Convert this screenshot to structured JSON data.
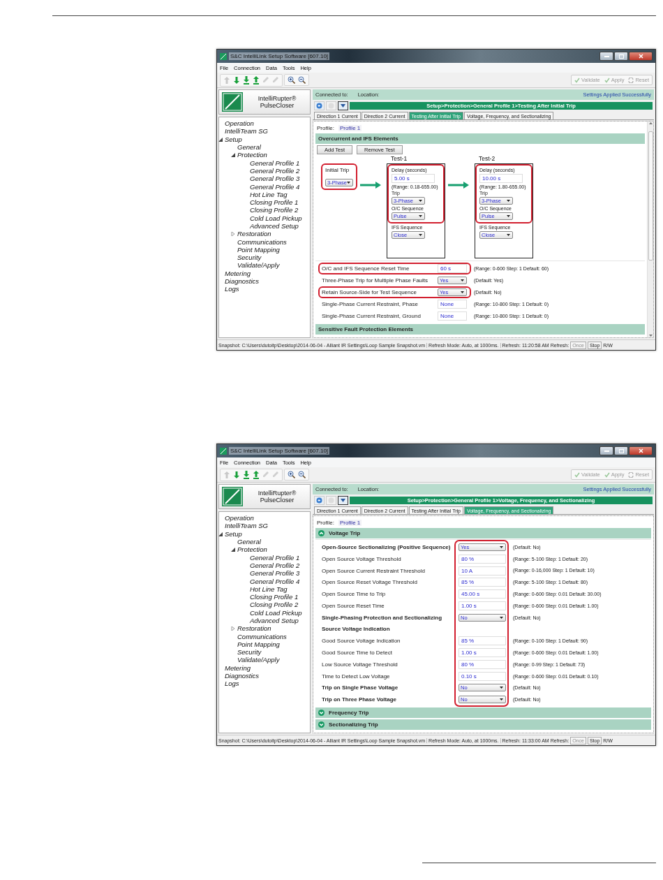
{
  "windows": [
    {
      "title": "S&C IntelliLink Setup Software [607.10]",
      "menu": [
        "File",
        "Connection",
        "Data",
        "Tools",
        "Help"
      ],
      "actions": [
        "Validate",
        "Apply",
        "Reset"
      ],
      "logo_lines": [
        "IntelliRupter®",
        "PulseCloser"
      ],
      "connected_label": "Connected to:",
      "location_label": "Location:",
      "status_message": "Settings Applied Successfully",
      "breadcrumb": "Setup>Protection>General Profile 1>Testing After Initial Trip",
      "tabs": [
        {
          "label": "Direction 1 Current",
          "selected": false
        },
        {
          "label": "Direction 2 Current",
          "selected": false
        },
        {
          "label": "Testing After Initial Trip",
          "selected": true
        },
        {
          "label": "Voltage, Frequency, and Sectionalizing",
          "selected": false
        }
      ],
      "sidebar": [
        {
          "label": "Operation"
        },
        {
          "label": "IntelliTeam SG"
        },
        {
          "label": "Setup",
          "expanded": true,
          "children": [
            {
              "label": "General"
            },
            {
              "label": "Protection",
              "expanded": true,
              "children": [
                {
                  "label": "General Profile 1"
                },
                {
                  "label": "General Profile 2"
                },
                {
                  "label": "General Profile 3"
                },
                {
                  "label": "General Profile 4"
                },
                {
                  "label": "Hot Line Tag"
                },
                {
                  "label": "Closing Profile 1"
                },
                {
                  "label": "Closing Profile 2"
                },
                {
                  "label": "Cold Load Pickup"
                },
                {
                  "label": "Advanced Setup"
                }
              ]
            },
            {
              "label": "Restoration",
              "expanded": false
            },
            {
              "label": "Communications"
            },
            {
              "label": "Point Mapping"
            },
            {
              "label": "Security"
            },
            {
              "label": "Validate/Apply"
            }
          ]
        },
        {
          "label": "Metering"
        },
        {
          "label": "Diagnostics"
        },
        {
          "label": "Logs"
        }
      ],
      "profile_label": "Profile:",
      "profile_value": "Profile 1",
      "blocks": [
        {
          "kind": "section",
          "title": "Overcurrent and IFS Elements"
        },
        {
          "kind": "buttons",
          "labels": [
            "Add Test",
            "Remove Test"
          ]
        },
        {
          "kind": "test_flow",
          "initial": {
            "label": "Initial Trip",
            "value": "3-Phase",
            "highlighted": true
          },
          "tests": [
            {
              "title": "Test-1",
              "delay_label": "Delay (seconds)",
              "delay": "5.00 s",
              "range": "(Range: 0.18-655.00)",
              "trip_label": "Trip",
              "trip": "3-Phase",
              "oc_label": "O/C Sequence",
              "oc": "Pulse",
              "ifs_label": "IFS Sequence",
              "ifs": "Close",
              "highlighted": true
            },
            {
              "title": "Test-2",
              "delay_label": "Delay (seconds)",
              "delay": "10.00 s",
              "range": "(Range: 1.80-655.00)",
              "trip_label": "Trip",
              "trip": "3-Phase",
              "oc_label": "O/C Sequence",
              "oc": "Pulse",
              "ifs_label": "IFS Sequence",
              "ifs": "Close",
              "highlighted": true
            }
          ]
        },
        {
          "kind": "settings",
          "value_column_highlighted": false,
          "rows": [
            {
              "kind": "text",
              "label": "O/C and IFS Sequence Reset Time",
              "value": "60 s",
              "hint": "(Range: 0-600 Step: 1 Default: 60)",
              "bold": false,
              "highlighted": true
            },
            {
              "kind": "select",
              "label": "Three-Phase Trip for Multiple Phase Faults",
              "value": "Yes",
              "hint": "(Default: Yes)",
              "bold": false,
              "highlighted": false
            },
            {
              "kind": "select",
              "label": "Retain Source-Side for Test Sequence",
              "value": "Yes",
              "hint": "(Default: No)",
              "bold": false,
              "highlighted": true
            },
            {
              "kind": "text",
              "label": "Single-Phase Current Restraint, Phase",
              "value": "None",
              "hint": "(Range: 10-800 Step: 1 Default: 0)",
              "bold": false,
              "highlighted": false
            },
            {
              "kind": "text",
              "label": "Single-Phase Current Restraint, Ground",
              "value": "None",
              "hint": "(Range: 10-800 Step: 1 Default: 0)",
              "bold": false,
              "highlighted": false
            }
          ]
        },
        {
          "kind": "section",
          "title": "Sensitive Fault Protection Elements"
        }
      ],
      "status": {
        "snapshot": "Snapshot: C:\\Users\\dutoitp\\Desktop\\2014-06-04 - Alliant IR Settings\\Loop Sample Snapshot.vm",
        "refresh_mode": "Refresh Mode: Auto, at 1000ms.",
        "refresh_time": "Refresh: 11:20:58 AM",
        "refresh_label": "Refresh:",
        "once": "Once",
        "stop": "Stop",
        "mode": "R/W"
      }
    },
    {
      "title": "S&C IntelliLink Setup Software [607.10]",
      "menu": [
        "File",
        "Connection",
        "Data",
        "Tools",
        "Help"
      ],
      "actions": [
        "Validate",
        "Apply",
        "Reset"
      ],
      "logo_lines": [
        "IntelliRupter®",
        "PulseCloser"
      ],
      "connected_label": "Connected to:",
      "location_label": "Location:",
      "status_message": "Settings Applied Successfully",
      "breadcrumb": "Setup>Protection>General Profile 1>Voltage, Frequency, and Sectionalizing",
      "tabs": [
        {
          "label": "Direction 1 Current",
          "selected": false
        },
        {
          "label": "Direction 2 Current",
          "selected": false
        },
        {
          "label": "Testing After Initial Trip",
          "selected": false
        },
        {
          "label": "Voltage, Frequency, and Sectionalizing",
          "selected": true
        }
      ],
      "sidebar": [
        {
          "label": "Operation"
        },
        {
          "label": "IntelliTeam SG"
        },
        {
          "label": "Setup",
          "expanded": true,
          "children": [
            {
              "label": "General"
            },
            {
              "label": "Protection",
              "expanded": true,
              "children": [
                {
                  "label": "General Profile 1"
                },
                {
                  "label": "General Profile 2"
                },
                {
                  "label": "General Profile 3"
                },
                {
                  "label": "General Profile 4"
                },
                {
                  "label": "Hot Line Tag"
                },
                {
                  "label": "Closing Profile 1"
                },
                {
                  "label": "Closing Profile 2"
                },
                {
                  "label": "Cold Load Pickup"
                },
                {
                  "label": "Advanced Setup"
                }
              ]
            },
            {
              "label": "Restoration",
              "expanded": false
            },
            {
              "label": "Communications"
            },
            {
              "label": "Point Mapping"
            },
            {
              "label": "Security"
            },
            {
              "label": "Validate/Apply"
            }
          ]
        },
        {
          "label": "Metering"
        },
        {
          "label": "Diagnostics"
        },
        {
          "label": "Logs"
        }
      ],
      "profile_label": "Profile:",
      "profile_value": "Profile 1",
      "blocks": [
        {
          "kind": "section",
          "title": "Voltage Trip",
          "expanded": true
        },
        {
          "kind": "settings",
          "value_column_highlighted": true,
          "rows": [
            {
              "kind": "select",
              "label": "Open-Source Sectionalizing (Positive Sequence)",
              "value": "Yes",
              "hint": "(Default: No)",
              "bold": true,
              "highlighted": false
            },
            {
              "kind": "text",
              "label": "Open Source Voltage Threshold",
              "value": "80 %",
              "hint": "(Range: 5-100 Step: 1 Default: 20)",
              "bold": false,
              "highlighted": false
            },
            {
              "kind": "text",
              "label": "Open Source Current Restraint Threshold",
              "value": "10 A",
              "hint": "(Range: 0-16,000 Step: 1 Default: 10)",
              "bold": false,
              "highlighted": false
            },
            {
              "kind": "text",
              "label": "Open Source Reset Voltage Threshold",
              "value": "85 %",
              "hint": "(Range: 5-100 Step: 1 Default: 80)",
              "bold": false,
              "highlighted": false
            },
            {
              "kind": "text",
              "label": "Open Source Time to Trip",
              "value": "45.00 s",
              "hint": "(Range: 0-600 Step: 0.01 Default: 30.00)",
              "bold": false,
              "highlighted": false
            },
            {
              "kind": "text",
              "label": "Open Source Reset Time",
              "value": "1.00 s",
              "hint": "(Range: 0-600 Step: 0.01 Default: 1.00)",
              "bold": false,
              "highlighted": false
            },
            {
              "kind": "select",
              "label": "Single-Phasing Protection and Sectionalizing",
              "value": "No",
              "hint": "(Default: No)",
              "bold": true,
              "highlighted": false
            },
            {
              "kind": "heading",
              "label": "Source Voltage Indication",
              "bold": true,
              "highlighted": false
            },
            {
              "kind": "text",
              "label": "Good Source Voltage Indication",
              "value": "85 %",
              "hint": "(Range: 0-100 Step: 1 Default: 90)",
              "bold": false,
              "highlighted": false
            },
            {
              "kind": "text",
              "label": "Good Source Time to Detect",
              "value": "1.00 s",
              "hint": "(Range: 0-600 Step: 0.01 Default: 1.00)",
              "bold": false,
              "highlighted": false
            },
            {
              "kind": "text",
              "label": "Low Source Voltage Threshold",
              "value": "80 %",
              "hint": "(Range: 0-99 Step: 1 Default: 73)",
              "bold": false,
              "highlighted": false
            },
            {
              "kind": "text",
              "label": "Time to Detect Low Voltage",
              "value": "0.10 s",
              "hint": "(Range: 0-600 Step: 0.01 Default: 0.10)",
              "bold": false,
              "highlighted": false
            },
            {
              "kind": "select",
              "label": "Trip on Single Phase Voltage",
              "value": "No",
              "hint": "(Default: No)",
              "bold": true,
              "highlighted": false
            },
            {
              "kind": "select",
              "label": "Trip on Three Phase Voltage",
              "value": "No",
              "hint": "(Default: No)",
              "bold": true,
              "highlighted": false
            }
          ]
        },
        {
          "kind": "section",
          "title": "Frequency Trip",
          "expanded": false
        },
        {
          "kind": "section",
          "title": "Sectionalizing Trip",
          "expanded": false
        }
      ],
      "status": {
        "snapshot": "Snapshot: C:\\Users\\dutoitp\\Desktop\\2014-06-04 - Alliant IR Settings\\Loop Sample Snapshot.vm",
        "refresh_mode": "Refresh Mode: Auto, at 1000ms.",
        "refresh_time": "Refresh: 11:33:00 AM",
        "refresh_label": "Refresh:",
        "once": "Once",
        "stop": "Stop",
        "mode": "R/W"
      }
    }
  ]
}
